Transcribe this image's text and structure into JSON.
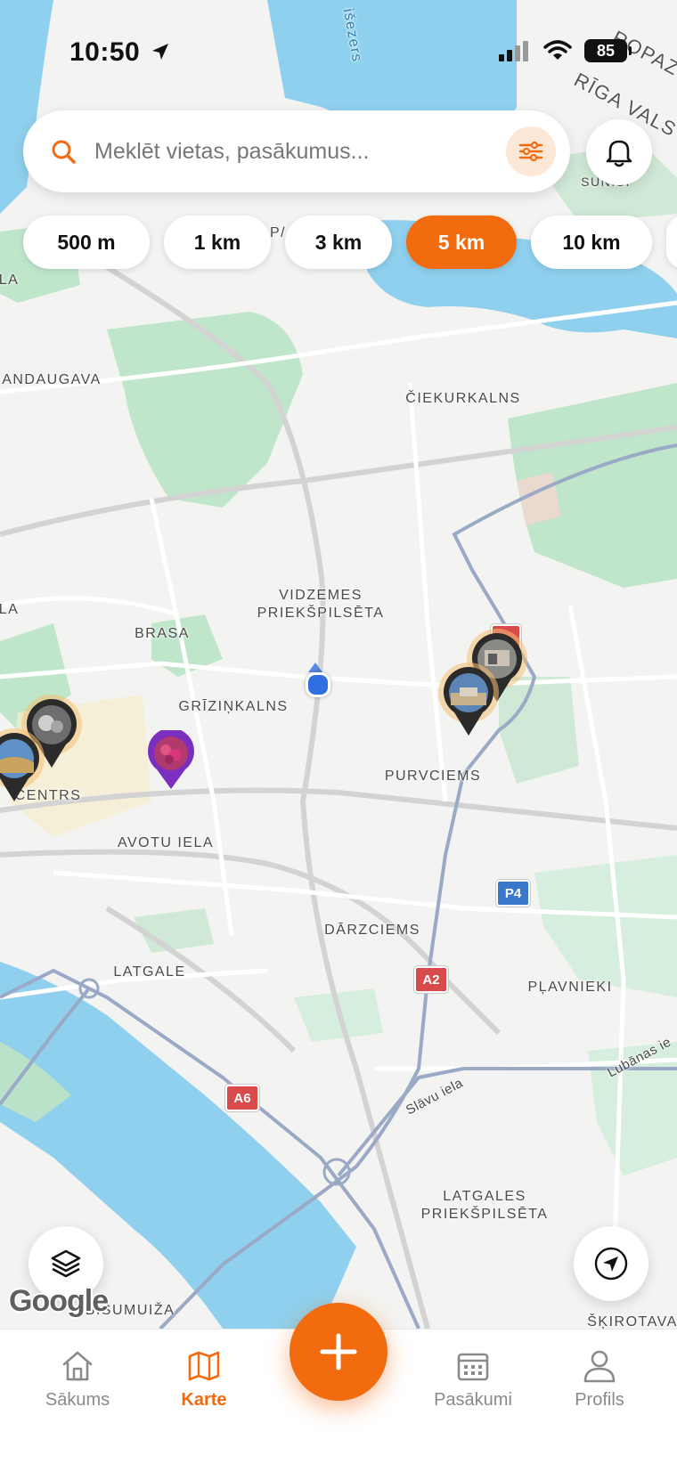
{
  "status_bar": {
    "time": "10:50",
    "battery": "85"
  },
  "search": {
    "placeholder": "Meklēt vietas, pasākumus..."
  },
  "radius_chips": [
    {
      "label": "500 m",
      "active": false
    },
    {
      "label": "1 km",
      "active": false
    },
    {
      "label": "3 km",
      "active": false
    },
    {
      "label": "5 km",
      "active": true
    },
    {
      "label": "10 km",
      "active": false
    }
  ],
  "map": {
    "labels": {
      "ciekurkalns": "ČIEKURKALNS",
      "andaugava": "ANDAUGAVA",
      "vidzemes": "VIDZEMES\nPRIEKŠPILSĒTA",
      "brasa": "BRASA",
      "grizinkalns": "GRĪZIŅKALNS",
      "purvciems": "PURVCIEMS",
      "centrs": "CENTRS",
      "avotu_iela": "AVOTU IELA",
      "darzciems": "DĀRZCIEMS",
      "latgale": "LATGALE",
      "plavnieki": "PĻAVNIEKI",
      "latgales": "LATGALES\nPRIEKŠPILSĒTA",
      "bisumuiza": "BIŠUMUIŽA",
      "skirotava": "ŠĶIROTAVA",
      "slavu_iela": "Slāvu iela",
      "lubanas": "Lubānas ie",
      "ezers": "išezers",
      "ropaz": "ROPAZ",
      "riga_vals": "RĪGA VALS",
      "sunisi": "SUNIŠI",
      "la_left": "LA",
      "la_mid": "LA",
      "p_top": "P/"
    },
    "shields": {
      "a2": "A2",
      "a6": "A6",
      "p4": "P4"
    },
    "google_logo": "Google"
  },
  "tabs": [
    {
      "label": "Sākums",
      "icon": "home-icon",
      "active": false
    },
    {
      "label": "Karte",
      "icon": "map-icon",
      "active": true
    },
    {
      "label": "Pasākumi",
      "icon": "calendar-icon",
      "active": false
    },
    {
      "label": "Profils",
      "icon": "profile-icon",
      "active": false
    }
  ],
  "colors": {
    "accent": "#f26b0f",
    "event_pin": "#7b2fbe",
    "user_dot": "#2f6fe0"
  }
}
